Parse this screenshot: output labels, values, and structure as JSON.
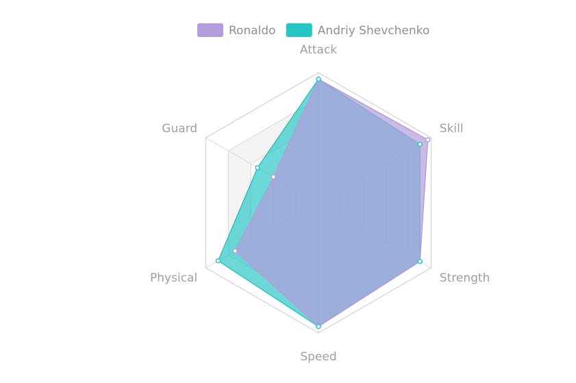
{
  "chart_data": {
    "type": "radar",
    "axes": [
      "Attack",
      "Skill",
      "Strength",
      "Speed",
      "Physical",
      "Guard"
    ],
    "rlim": [
      0,
      100
    ],
    "grid": true,
    "legend": "top",
    "series": [
      {
        "name": "Ronaldo",
        "values": [
          95,
          97,
          90,
          95,
          74,
          40
        ],
        "color": "#b39ddb"
      },
      {
        "name": "Andriy Shevchenko",
        "values": [
          95,
          90,
          90,
          95,
          89,
          54
        ],
        "color": "#26c6c6"
      }
    ],
    "colors": {
      "axis_label": "#9e9e9e",
      "grid_line": "#d7d7d7",
      "band_fill": "#f4f4f4",
      "blend": "#9eb0db"
    }
  }
}
